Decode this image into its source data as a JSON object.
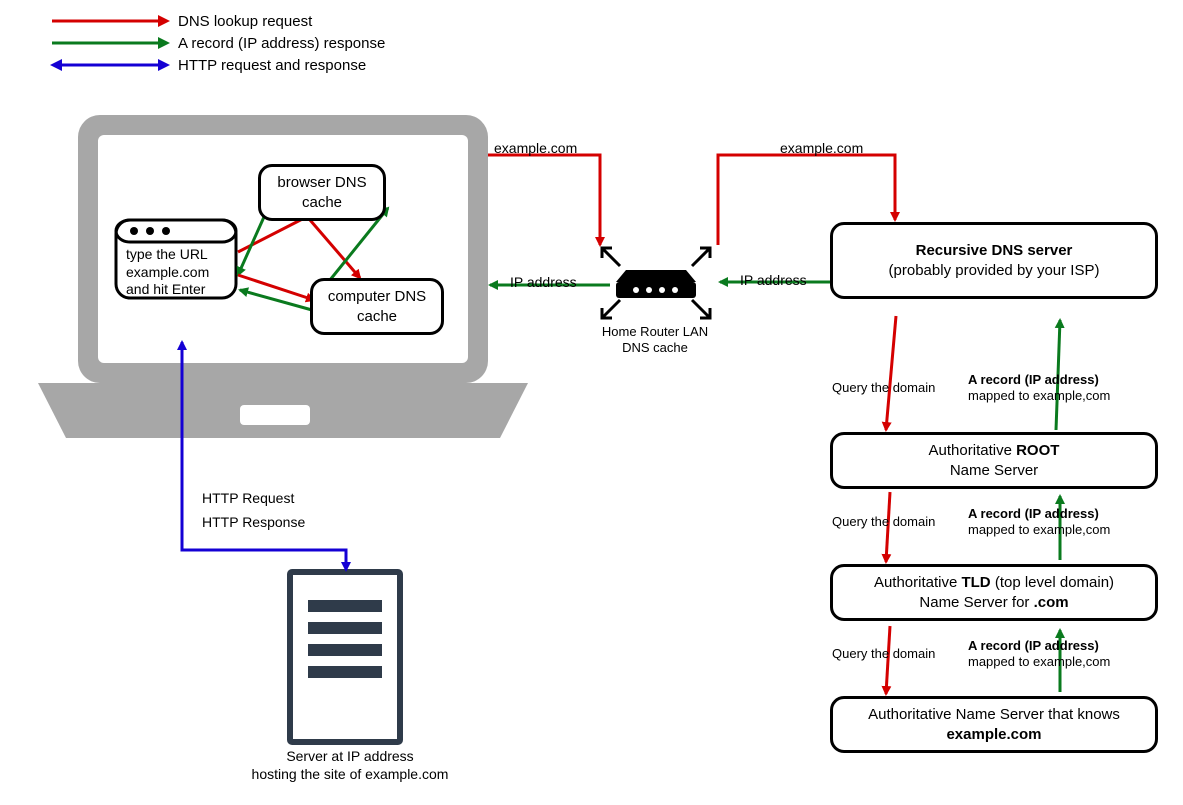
{
  "legend": {
    "dns_request": "DNS lookup request",
    "a_record_response": "A record (IP address) response",
    "http": "HTTP request and response"
  },
  "colors": {
    "red": "#d40000",
    "green": "#0a7a1e",
    "blue": "#1400d4",
    "laptop": "#a7a7a7",
    "server": "#2f3b4a"
  },
  "laptop": {
    "url_box": "type the URL example.com and hit Enter",
    "browser_cache": "browser DNS cache",
    "computer_cache": "computer DNS cache"
  },
  "router": {
    "label": "Home Router LAN DNS cache"
  },
  "flow_labels": {
    "example_com_1": "example.com",
    "example_com_2": "example.com",
    "ip_address_1": "IP address",
    "ip_address_2": "IP address",
    "query_1": "Query the domain",
    "query_2": "Query the domain",
    "query_3": "Query the domain",
    "a_record_line1": "A record (IP address)",
    "a_record_line2": "mapped to example,com",
    "http_request": "HTTP Request",
    "http_response": "HTTP Response"
  },
  "dns_boxes": {
    "recursive_line1": "Recursive DNS server",
    "recursive_line2": "(probably provided by your ISP)",
    "root_line1_prefix": "Authoritative ",
    "root_line1_bold": "ROOT",
    "root_line2": "Name Server",
    "tld_line1_prefix": "Authoritative ",
    "tld_line1_bold": "TLD",
    "tld_line1_suffix": " (top level domain)",
    "tld_line2_prefix": "Name Server for ",
    "tld_line2_bold": ".com",
    "example_line1": "Authoritative Name Server that knows",
    "example_line2": "example.com"
  },
  "server": {
    "caption_line1": "Server at IP address",
    "caption_line2": "hosting the site of example.com"
  }
}
